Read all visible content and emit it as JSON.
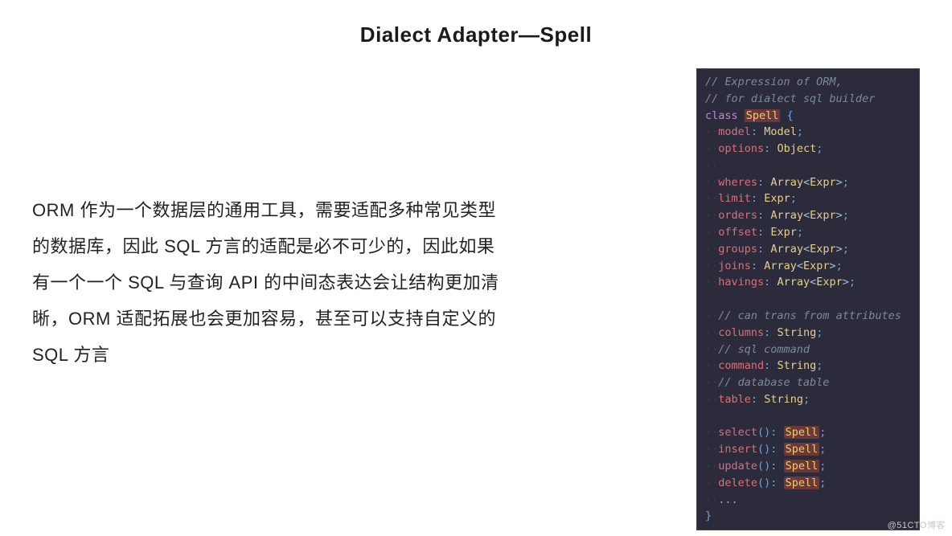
{
  "title": "Dialect Adapter—Spell",
  "body": "ORM 作为一个数据层的通用工具，需要适配多种常见类型的数据库，因此 SQL 方言的适配是必不可少的，因此如果有一个一个 SQL 与查询 API 的中间态表达会让结构更加清晰，ORM 适配拓展也会更加容易，甚至可以支持自定义的 SQL 方言",
  "code": {
    "comment1": "// Expression of ORM,",
    "comment2": "// for dialect sql builder",
    "class_kw": "class",
    "class_name": "Spell",
    "open_brace": " {",
    "block1": [
      {
        "prop": "model",
        "type": "Model"
      },
      {
        "prop": "options",
        "type": "Object"
      }
    ],
    "block2": [
      {
        "prop": "wheres",
        "type": "Array",
        "gen": "Expr"
      },
      {
        "prop": "limit",
        "type": "Expr"
      },
      {
        "prop": "orders",
        "type": "Array",
        "gen": "Expr"
      },
      {
        "prop": "offset",
        "type": "Expr"
      },
      {
        "prop": "groups",
        "type": "Array",
        "gen": "Expr"
      },
      {
        "prop": "joins",
        "type": "Array",
        "gen": "Expr"
      },
      {
        "prop": "havings",
        "type": "Array",
        "gen": "Expr"
      }
    ],
    "comment3": "// can trans from attributes",
    "block3a": {
      "prop": "columns",
      "type": "String"
    },
    "comment4": "// sql command",
    "block3b": {
      "prop": "command",
      "type": "String"
    },
    "comment5": "// database table",
    "block3c": {
      "prop": "table",
      "type": "String"
    },
    "methods": [
      {
        "name": "select",
        "ret": "Spell"
      },
      {
        "name": "insert",
        "ret": "Spell"
      },
      {
        "name": "update",
        "ret": "Spell"
      },
      {
        "name": "delete",
        "ret": "Spell"
      }
    ],
    "dots": "...",
    "close_brace": "}"
  },
  "watermark": "@51CTO博客"
}
